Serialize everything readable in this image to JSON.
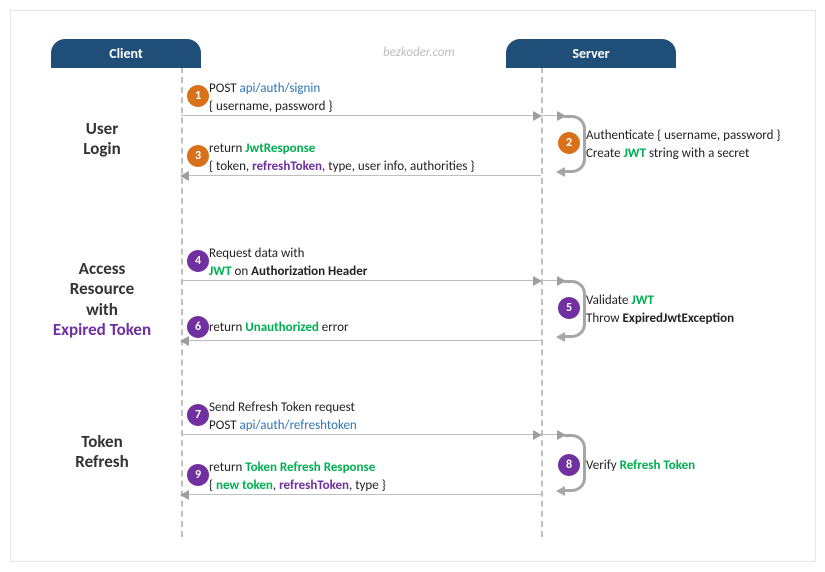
{
  "headers": {
    "client": "Client",
    "server": "Server"
  },
  "watermark": "bezkoder.com",
  "sections": {
    "login": {
      "l1": "User",
      "l2": "Login"
    },
    "access": {
      "l1": "Access",
      "l2": "Resource",
      "l3": "with",
      "l4": "Expired Token"
    },
    "refresh": {
      "l1": "Token",
      "l2": "Refresh"
    }
  },
  "steps": {
    "n1": {
      "num": "1",
      "text_pre": "POST ",
      "endpoint": "api/auth/signin",
      "body": "{ username, password }"
    },
    "n2": {
      "num": "2",
      "l1_pre": "Authenticate { username, password }",
      "l2_pre": "Create ",
      "l2_kw": "JWT",
      "l2_post": " string with a secret"
    },
    "n3": {
      "num": "3",
      "ret": "return ",
      "resp": "JwtResponse",
      "body_pre": "{ token, ",
      "body_kw": "refreshToken",
      "body_post": ", type, user info, authorities }"
    },
    "n4": {
      "num": "4",
      "l1": "Request data with",
      "l2_kw": "JWT",
      "l2_mid": " on ",
      "l2_b": "Authorization Header"
    },
    "n5": {
      "num": "5",
      "l1_pre": "Validate ",
      "l1_kw": "JWT",
      "l2_pre": "Throw ",
      "l2_b": "ExpiredJwtException"
    },
    "n6": {
      "num": "6",
      "ret": "return ",
      "kw": "Unauthorized",
      "post": " error"
    },
    "n7": {
      "num": "7",
      "l1": "Send Refresh Token request",
      "l2_pre": "POST ",
      "l2_ep": "api/auth/refreshtoken"
    },
    "n8": {
      "num": "8",
      "pre": "Verify ",
      "kw": "Refresh Token"
    },
    "n9": {
      "num": "9",
      "ret": "return ",
      "resp": "Token Refresh Response",
      "body_pre": "{ ",
      "body_kw1": "new token",
      "body_mid": ", ",
      "body_kw2": "refreshToken",
      "body_post": ", type }"
    }
  }
}
